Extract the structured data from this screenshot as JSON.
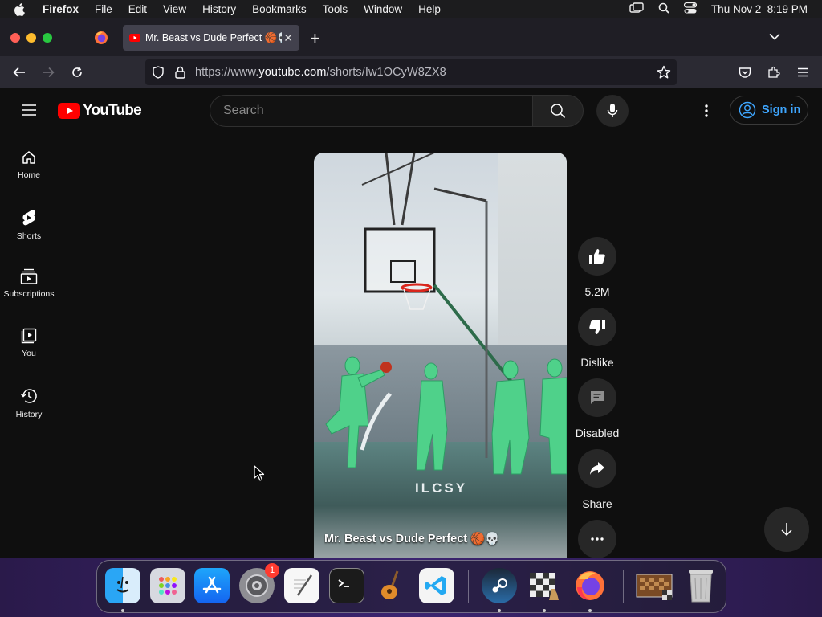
{
  "menubar": {
    "app_name": "Firefox",
    "items": [
      "File",
      "Edit",
      "View",
      "History",
      "Bookmarks",
      "Tools",
      "Window",
      "Help"
    ],
    "datetime": "Thu Nov 2  8:19 PM"
  },
  "browser": {
    "tab_title": "Mr. Beast vs Dude Perfect 🏀💀",
    "url_prefix": "https://www.",
    "url_domain": "youtube.com",
    "url_path": "/shorts/Iw1OCyW8ZX8"
  },
  "youtube": {
    "logo_text": "YouTube",
    "search_placeholder": "Search",
    "signin_label": "Sign in",
    "sidebar": [
      {
        "label": "Home",
        "icon": "home-icon"
      },
      {
        "label": "Shorts",
        "icon": "shorts-icon"
      },
      {
        "label": "Subscriptions",
        "icon": "subscriptions-icon"
      },
      {
        "label": "You",
        "icon": "you-icon"
      },
      {
        "label": "History",
        "icon": "history-icon"
      }
    ],
    "video": {
      "caption": "Mr. Beast vs Dude Perfect 🏀💀",
      "watermark": "ILCSY"
    },
    "actions": {
      "like_count": "5.2M",
      "dislike_label": "Dislike",
      "comments_label": "Disabled",
      "share_label": "Share"
    }
  },
  "dock": {
    "apps": [
      "finder",
      "launchpad",
      "app-store",
      "system-settings",
      "textedit",
      "terminal",
      "garageband",
      "vscode",
      "steam",
      "chess",
      "firefox",
      "chess-window",
      "trash"
    ],
    "settings_badge": "1"
  },
  "colors": {
    "youtube_red": "#ff0000",
    "signin_blue": "#3ea6ff",
    "page_bg": "#0f0f0f"
  }
}
